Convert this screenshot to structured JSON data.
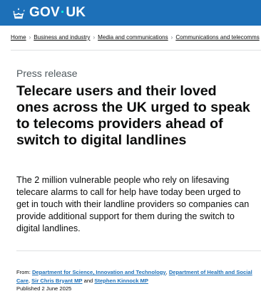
{
  "header": {
    "logo_text_left": "GOV",
    "logo_dot": "·",
    "logo_text_right": "UK",
    "logo_icon": "crown-icon",
    "brand_color": "#1d70b8"
  },
  "breadcrumbs": {
    "items": [
      "Home",
      "Business and industry",
      "Media and communications",
      "Communications and telecomms"
    ],
    "separator": "›"
  },
  "article": {
    "caption": "Press release",
    "title": "Telecare users and their loved ones across the UK urged to speak to telecoms providers ahead of switch to digital landlines",
    "lede": "The 2 million vulnerable people who rely on lifesaving telecare alarms to call for help have today been urged to get in touch with their landline providers so companies can provide additional support for them during the switch to digital landlines."
  },
  "meta": {
    "from_label": "From:",
    "org_1": "Department for Science, Innovation and Technology",
    "sep_1": ",",
    "org_2": "Department of Health and Social Care",
    "sep_2": ",",
    "person_1": "Sir Chris Bryant MP",
    "and_text": "and",
    "person_2": "Stephen Kinnock MP",
    "published": "Published 2 June 2025"
  }
}
